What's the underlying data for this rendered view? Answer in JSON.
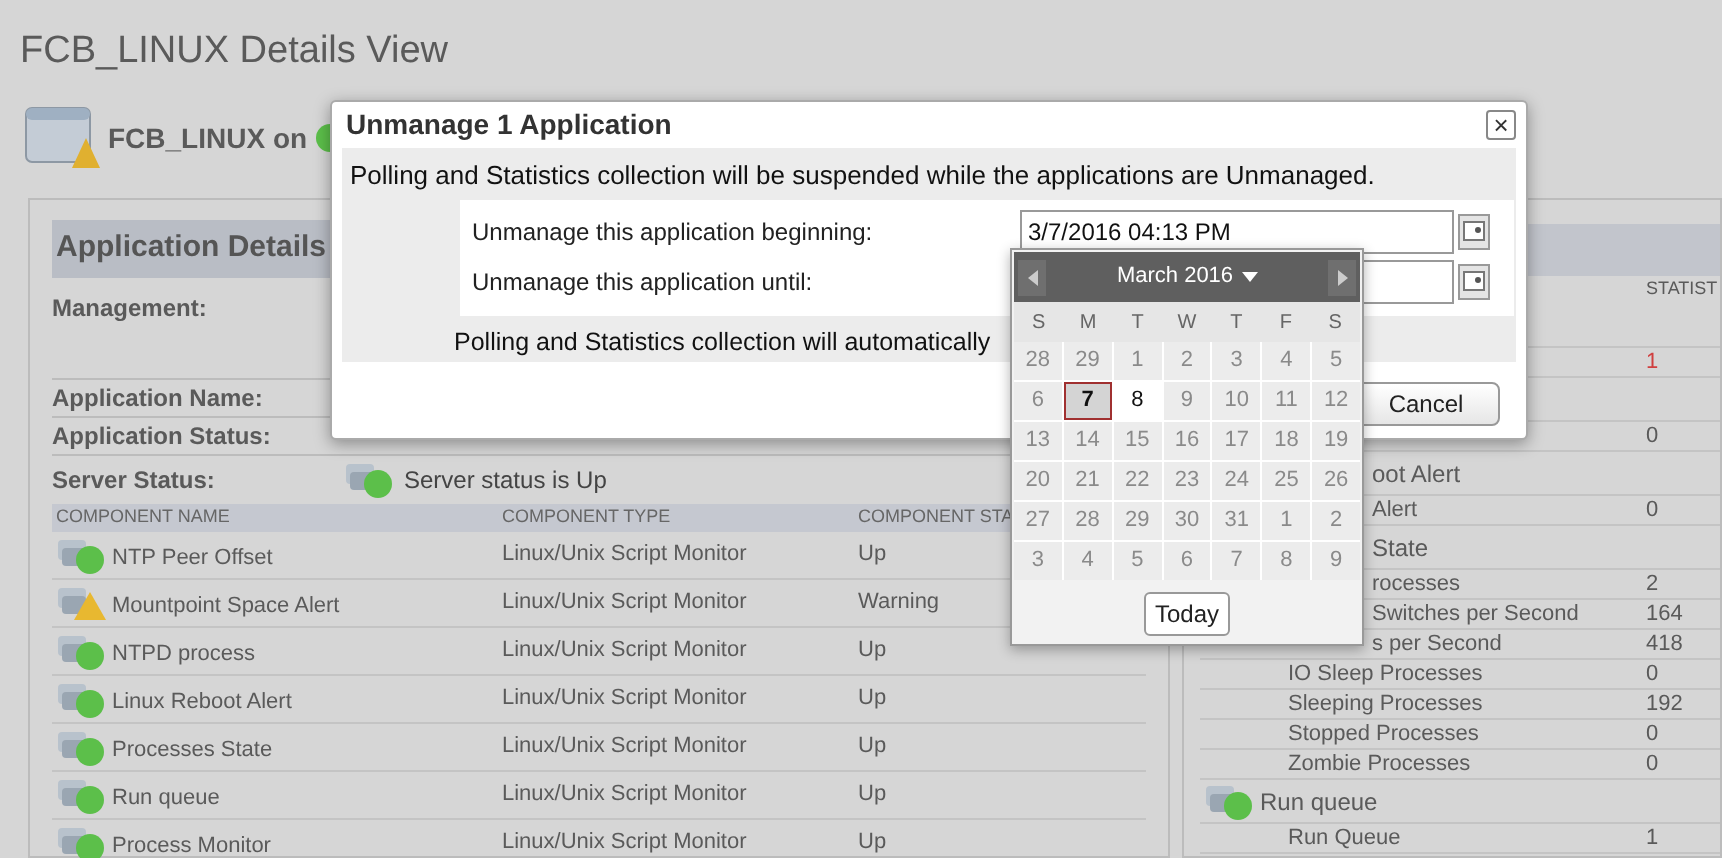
{
  "page_title": "FCB_LINUX Details View",
  "node": {
    "label": "FCB_LINUX on"
  },
  "application_details": {
    "title": "Application Details",
    "fields": [
      {
        "label": "Management:"
      },
      {
        "label": "Application Name:"
      },
      {
        "label": "Application Status:"
      }
    ],
    "server_status": {
      "label": "Server Status:",
      "value": "Server status is Up",
      "kind": "up"
    },
    "table": {
      "columns": [
        "COMPONENT NAME",
        "COMPONENT TYPE",
        "COMPONENT STA"
      ],
      "rows": [
        {
          "name": "NTP Peer Offset",
          "type": "Linux/Unix Script Monitor",
          "status_text": "Up",
          "kind": "up"
        },
        {
          "name": "Mountpoint Space Alert",
          "type": "Linux/Unix Script Monitor",
          "status_text": "Warning",
          "kind": "warning"
        },
        {
          "name": "NTPD process",
          "type": "Linux/Unix Script Monitor",
          "status_text": "Up",
          "kind": "up"
        },
        {
          "name": "Linux Reboot Alert",
          "type": "Linux/Unix Script Monitor",
          "status_text": "Up",
          "kind": "up"
        },
        {
          "name": "Processes State",
          "type": "Linux/Unix Script Monitor",
          "status_text": "Up",
          "kind": "up"
        },
        {
          "name": "Run queue",
          "type": "Linux/Unix Script Monitor",
          "status_text": "Up",
          "kind": "up"
        },
        {
          "name": "Process Monitor",
          "type": "Linux/Unix Script Monitor",
          "status_text": "Up",
          "kind": "up"
        }
      ]
    }
  },
  "statistics_panel": {
    "column": "STATIST",
    "rows": [
      {
        "kind": "stat",
        "value": "1",
        "alert": true
      },
      {
        "kind": "stat",
        "value": "0",
        "alert": false
      },
      {
        "kind": "group",
        "label": "oot Alert",
        "partial": true
      },
      {
        "kind": "stat",
        "label": "Alert",
        "value": "0",
        "alert": false,
        "partial": true
      },
      {
        "kind": "group",
        "label": "State",
        "partial": true
      },
      {
        "kind": "stat",
        "label": "rocesses",
        "value": "2",
        "alert": false,
        "partial": true
      },
      {
        "kind": "stat",
        "label": "Switches per Second",
        "value": "164",
        "alert": false,
        "partial": true
      },
      {
        "kind": "stat",
        "label": "s per Second",
        "value": "418",
        "alert": false,
        "partial": true
      },
      {
        "kind": "stat",
        "label": "IO Sleep Processes",
        "value": "0",
        "alert": false
      },
      {
        "kind": "stat",
        "label": "Sleeping Processes",
        "value": "192",
        "alert": false
      },
      {
        "kind": "stat",
        "label": "Stopped Processes",
        "value": "0",
        "alert": false
      },
      {
        "kind": "stat",
        "label": "Zombie Processes",
        "value": "0",
        "alert": false
      },
      {
        "kind": "group",
        "label": "Run queue",
        "icon": true
      },
      {
        "kind": "stat",
        "label": "Run Queue",
        "value": "1",
        "alert": false
      }
    ]
  },
  "dialog": {
    "title": "Unmanage 1 Application",
    "close": "×",
    "intro": "Polling and Statistics collection will be suspended while the applications are Unmanaged.",
    "fields": [
      {
        "label": "Unmanage this application beginning:",
        "value": "3/7/2016 04:13 PM"
      },
      {
        "label": "Unmanage this application until:"
      }
    ],
    "note": "Polling and Statistics collection will automatically",
    "buttons": [
      "Cancel"
    ]
  },
  "calendar": {
    "month": "March 2016",
    "weekdays": [
      "S",
      "M",
      "T",
      "W",
      "T",
      "F",
      "S"
    ],
    "weeks": [
      [
        {
          "day": "28",
          "disabled": true,
          "selected": false
        },
        {
          "day": "29",
          "disabled": true,
          "selected": false
        },
        {
          "day": "1",
          "disabled": true,
          "selected": false
        },
        {
          "day": "2",
          "disabled": true,
          "selected": false
        },
        {
          "day": "3",
          "disabled": true,
          "selected": false
        },
        {
          "day": "4",
          "disabled": true,
          "selected": false
        },
        {
          "day": "5",
          "disabled": true,
          "selected": false
        }
      ],
      [
        {
          "day": "6",
          "disabled": true,
          "selected": false
        },
        {
          "day": "7",
          "disabled": false,
          "selected": true
        },
        {
          "day": "8",
          "disabled": false,
          "selected": false
        },
        {
          "day": "9",
          "disabled": true,
          "selected": false
        },
        {
          "day": "10",
          "disabled": true,
          "selected": false
        },
        {
          "day": "11",
          "disabled": true,
          "selected": false
        },
        {
          "day": "12",
          "disabled": true,
          "selected": false
        }
      ],
      [
        {
          "day": "13",
          "disabled": true,
          "selected": false
        },
        {
          "day": "14",
          "disabled": true,
          "selected": false
        },
        {
          "day": "15",
          "disabled": true,
          "selected": false
        },
        {
          "day": "16",
          "disabled": true,
          "selected": false
        },
        {
          "day": "17",
          "disabled": true,
          "selected": false
        },
        {
          "day": "18",
          "disabled": true,
          "selected": false
        },
        {
          "day": "19",
          "disabled": true,
          "selected": false
        }
      ],
      [
        {
          "day": "20",
          "disabled": true,
          "selected": false
        },
        {
          "day": "21",
          "disabled": true,
          "selected": false
        },
        {
          "day": "22",
          "disabled": true,
          "selected": false
        },
        {
          "day": "23",
          "disabled": true,
          "selected": false
        },
        {
          "day": "24",
          "disabled": true,
          "selected": false
        },
        {
          "day": "25",
          "disabled": true,
          "selected": false
        },
        {
          "day": "26",
          "disabled": true,
          "selected": false
        }
      ],
      [
        {
          "day": "27",
          "disabled": true,
          "selected": false
        },
        {
          "day": "28",
          "disabled": true,
          "selected": false
        },
        {
          "day": "29",
          "disabled": true,
          "selected": false
        },
        {
          "day": "30",
          "disabled": true,
          "selected": false
        },
        {
          "day": "31",
          "disabled": true,
          "selected": false
        },
        {
          "day": "1",
          "disabled": true,
          "selected": false
        },
        {
          "day": "2",
          "disabled": true,
          "selected": false
        }
      ],
      [
        {
          "day": "3",
          "disabled": true,
          "selected": false
        },
        {
          "day": "4",
          "disabled": true,
          "selected": false
        },
        {
          "day": "5",
          "disabled": true,
          "selected": false
        },
        {
          "day": "6",
          "disabled": true,
          "selected": false
        },
        {
          "day": "7",
          "disabled": true,
          "selected": false
        },
        {
          "day": "8",
          "disabled": true,
          "selected": false
        },
        {
          "day": "9",
          "disabled": true,
          "selected": false
        }
      ]
    ],
    "today": "Today"
  }
}
